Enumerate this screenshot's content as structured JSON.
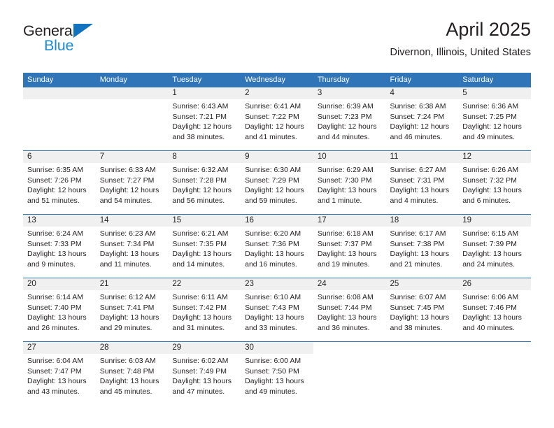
{
  "brand": {
    "name_top": "General",
    "name_bottom": "Blue",
    "triangle_icon": "triangle-icon"
  },
  "header": {
    "title": "April 2025",
    "location": "Divernon, Illinois, United States"
  },
  "colors": {
    "header_blue": "#3075b8",
    "row_divider_blue": "#2e75b6",
    "band_gray": "#f0f0f0",
    "brand_blue": "#1c8ad6",
    "text": "#231f20"
  },
  "calendar": {
    "day_headers": [
      "Sunday",
      "Monday",
      "Tuesday",
      "Wednesday",
      "Thursday",
      "Friday",
      "Saturday"
    ],
    "weeks": [
      [
        {
          "day": "",
          "lines": [
            "",
            "",
            "",
            ""
          ]
        },
        {
          "day": "",
          "lines": [
            "",
            "",
            "",
            ""
          ]
        },
        {
          "day": "1",
          "lines": [
            "Sunrise: 6:43 AM",
            "Sunset: 7:21 PM",
            "Daylight: 12 hours",
            "and 38 minutes."
          ]
        },
        {
          "day": "2",
          "lines": [
            "Sunrise: 6:41 AM",
            "Sunset: 7:22 PM",
            "Daylight: 12 hours",
            "and 41 minutes."
          ]
        },
        {
          "day": "3",
          "lines": [
            "Sunrise: 6:39 AM",
            "Sunset: 7:23 PM",
            "Daylight: 12 hours",
            "and 44 minutes."
          ]
        },
        {
          "day": "4",
          "lines": [
            "Sunrise: 6:38 AM",
            "Sunset: 7:24 PM",
            "Daylight: 12 hours",
            "and 46 minutes."
          ]
        },
        {
          "day": "5",
          "lines": [
            "Sunrise: 6:36 AM",
            "Sunset: 7:25 PM",
            "Daylight: 12 hours",
            "and 49 minutes."
          ]
        }
      ],
      [
        {
          "day": "6",
          "lines": [
            "Sunrise: 6:35 AM",
            "Sunset: 7:26 PM",
            "Daylight: 12 hours",
            "and 51 minutes."
          ]
        },
        {
          "day": "7",
          "lines": [
            "Sunrise: 6:33 AM",
            "Sunset: 7:27 PM",
            "Daylight: 12 hours",
            "and 54 minutes."
          ]
        },
        {
          "day": "8",
          "lines": [
            "Sunrise: 6:32 AM",
            "Sunset: 7:28 PM",
            "Daylight: 12 hours",
            "and 56 minutes."
          ]
        },
        {
          "day": "9",
          "lines": [
            "Sunrise: 6:30 AM",
            "Sunset: 7:29 PM",
            "Daylight: 12 hours",
            "and 59 minutes."
          ]
        },
        {
          "day": "10",
          "lines": [
            "Sunrise: 6:29 AM",
            "Sunset: 7:30 PM",
            "Daylight: 13 hours",
            "and 1 minute."
          ]
        },
        {
          "day": "11",
          "lines": [
            "Sunrise: 6:27 AM",
            "Sunset: 7:31 PM",
            "Daylight: 13 hours",
            "and 4 minutes."
          ]
        },
        {
          "day": "12",
          "lines": [
            "Sunrise: 6:26 AM",
            "Sunset: 7:32 PM",
            "Daylight: 13 hours",
            "and 6 minutes."
          ]
        }
      ],
      [
        {
          "day": "13",
          "lines": [
            "Sunrise: 6:24 AM",
            "Sunset: 7:33 PM",
            "Daylight: 13 hours",
            "and 9 minutes."
          ]
        },
        {
          "day": "14",
          "lines": [
            "Sunrise: 6:23 AM",
            "Sunset: 7:34 PM",
            "Daylight: 13 hours",
            "and 11 minutes."
          ]
        },
        {
          "day": "15",
          "lines": [
            "Sunrise: 6:21 AM",
            "Sunset: 7:35 PM",
            "Daylight: 13 hours",
            "and 14 minutes."
          ]
        },
        {
          "day": "16",
          "lines": [
            "Sunrise: 6:20 AM",
            "Sunset: 7:36 PM",
            "Daylight: 13 hours",
            "and 16 minutes."
          ]
        },
        {
          "day": "17",
          "lines": [
            "Sunrise: 6:18 AM",
            "Sunset: 7:37 PM",
            "Daylight: 13 hours",
            "and 19 minutes."
          ]
        },
        {
          "day": "18",
          "lines": [
            "Sunrise: 6:17 AM",
            "Sunset: 7:38 PM",
            "Daylight: 13 hours",
            "and 21 minutes."
          ]
        },
        {
          "day": "19",
          "lines": [
            "Sunrise: 6:15 AM",
            "Sunset: 7:39 PM",
            "Daylight: 13 hours",
            "and 24 minutes."
          ]
        }
      ],
      [
        {
          "day": "20",
          "lines": [
            "Sunrise: 6:14 AM",
            "Sunset: 7:40 PM",
            "Daylight: 13 hours",
            "and 26 minutes."
          ]
        },
        {
          "day": "21",
          "lines": [
            "Sunrise: 6:12 AM",
            "Sunset: 7:41 PM",
            "Daylight: 13 hours",
            "and 29 minutes."
          ]
        },
        {
          "day": "22",
          "lines": [
            "Sunrise: 6:11 AM",
            "Sunset: 7:42 PM",
            "Daylight: 13 hours",
            "and 31 minutes."
          ]
        },
        {
          "day": "23",
          "lines": [
            "Sunrise: 6:10 AM",
            "Sunset: 7:43 PM",
            "Daylight: 13 hours",
            "and 33 minutes."
          ]
        },
        {
          "day": "24",
          "lines": [
            "Sunrise: 6:08 AM",
            "Sunset: 7:44 PM",
            "Daylight: 13 hours",
            "and 36 minutes."
          ]
        },
        {
          "day": "25",
          "lines": [
            "Sunrise: 6:07 AM",
            "Sunset: 7:45 PM",
            "Daylight: 13 hours",
            "and 38 minutes."
          ]
        },
        {
          "day": "26",
          "lines": [
            "Sunrise: 6:06 AM",
            "Sunset: 7:46 PM",
            "Daylight: 13 hours",
            "and 40 minutes."
          ]
        }
      ],
      [
        {
          "day": "27",
          "lines": [
            "Sunrise: 6:04 AM",
            "Sunset: 7:47 PM",
            "Daylight: 13 hours",
            "and 43 minutes."
          ]
        },
        {
          "day": "28",
          "lines": [
            "Sunrise: 6:03 AM",
            "Sunset: 7:48 PM",
            "Daylight: 13 hours",
            "and 45 minutes."
          ]
        },
        {
          "day": "29",
          "lines": [
            "Sunrise: 6:02 AM",
            "Sunset: 7:49 PM",
            "Daylight: 13 hours",
            "and 47 minutes."
          ]
        },
        {
          "day": "30",
          "lines": [
            "Sunrise: 6:00 AM",
            "Sunset: 7:50 PM",
            "Daylight: 13 hours",
            "and 49 minutes."
          ]
        },
        {
          "day": "",
          "lines": [
            "",
            "",
            "",
            ""
          ]
        },
        {
          "day": "",
          "lines": [
            "",
            "",
            "",
            ""
          ]
        },
        {
          "day": "",
          "lines": [
            "",
            "",
            "",
            ""
          ]
        }
      ]
    ]
  }
}
